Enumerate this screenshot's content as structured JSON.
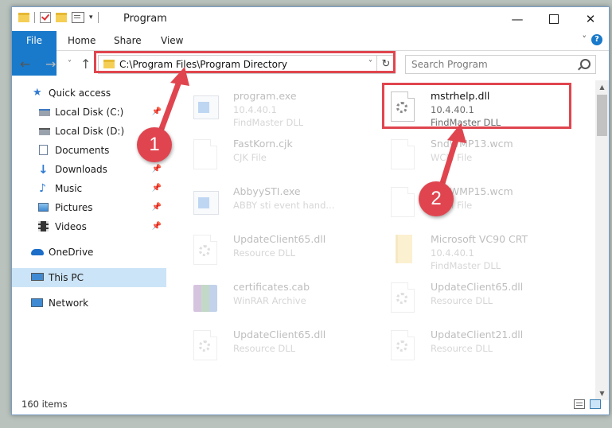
{
  "window": {
    "title": "Program",
    "controls": {
      "minimize": "—",
      "maximize": "",
      "close": "✕"
    }
  },
  "ribbon": {
    "tabs": [
      {
        "label": "File"
      },
      {
        "label": "Home"
      },
      {
        "label": "Share"
      },
      {
        "label": "View"
      }
    ],
    "help": "?"
  },
  "navbar": {
    "back": "←",
    "forward": "→",
    "recent": "˅",
    "up": "↑",
    "address": "C:\\Program Files\\Program Directory",
    "refresh": "↻",
    "search_placeholder": "Search Program"
  },
  "sidebar": {
    "items": [
      {
        "label": "Quick access",
        "icon": "star-icon",
        "pinned": false
      },
      {
        "label": "Local Disk (C:)",
        "icon": "drive-icon",
        "pinned": true
      },
      {
        "label": "Local Disk (D:)",
        "icon": "drive-icon",
        "pinned": false
      },
      {
        "label": "Documents",
        "icon": "documents-icon",
        "pinned": true
      },
      {
        "label": "Downloads",
        "icon": "download-icon",
        "pinned": true
      },
      {
        "label": "Music",
        "icon": "music-icon",
        "pinned": true
      },
      {
        "label": "Pictures",
        "icon": "pictures-icon",
        "pinned": true
      },
      {
        "label": "Videos",
        "icon": "videos-icon",
        "pinned": true
      },
      {
        "label": "OneDrive",
        "icon": "cloud-icon",
        "pinned": false
      },
      {
        "label": "This PC",
        "icon": "computer-icon",
        "pinned": false,
        "selected": true
      },
      {
        "label": "Network",
        "icon": "network-icon",
        "pinned": false
      }
    ]
  },
  "files": [
    {
      "name": "program.exe",
      "line1": "10.4.40.1",
      "line2": "FindMaster DLL",
      "icon": "exe-icon",
      "faded": true
    },
    {
      "name": "mstrhelp.dll",
      "line1": "10.4.40.1",
      "line2": "FindMaster DLL",
      "icon": "dll-gear-icon",
      "faded": false,
      "highlighted": true
    },
    {
      "name": "FastKorn.cjk",
      "line1": "CJK File",
      "line2": "",
      "icon": "blank-file-icon",
      "faded": true
    },
    {
      "name": "SndWMP13.wcm",
      "line1": "WCM File",
      "line2": "",
      "icon": "blank-file-icon",
      "faded": true
    },
    {
      "name": "AbbyySTI.exe",
      "line1": "ABBY sti event hand...",
      "line2": "",
      "icon": "exe-icon",
      "faded": true
    },
    {
      "name": "SndWMP15.wcm",
      "line1": "WCM File",
      "line2": "",
      "icon": "blank-file-icon",
      "faded": true
    },
    {
      "name": "UpdateClient65.dll",
      "line1": "Resource DLL",
      "line2": "",
      "icon": "dll-gear-icon",
      "faded": true
    },
    {
      "name": "Microsoft VC90 CRT",
      "line1": "10.4.40.1",
      "line2": "FindMaster DLL",
      "icon": "folder-icon",
      "faded": true
    },
    {
      "name": "certificates.cab",
      "line1": "WinRAR Archive",
      "line2": "",
      "icon": "winrar-icon",
      "faded": true
    },
    {
      "name": "UpdateClient65.dll",
      "line1": "Resource DLL",
      "line2": "",
      "icon": "dll-gear-icon",
      "faded": true
    },
    {
      "name": "UpdateClient65.dll",
      "line1": "Resource DLL",
      "line2": "",
      "icon": "dll-gear-icon",
      "faded": true
    },
    {
      "name": "UpdateClient21.dll",
      "line1": "Resource DLL",
      "line2": "",
      "icon": "dll-gear-icon",
      "faded": true
    }
  ],
  "status": {
    "items_count": "160 items"
  },
  "annotations": {
    "badge1": "1",
    "badge2": "2",
    "color": "#e0454f"
  }
}
